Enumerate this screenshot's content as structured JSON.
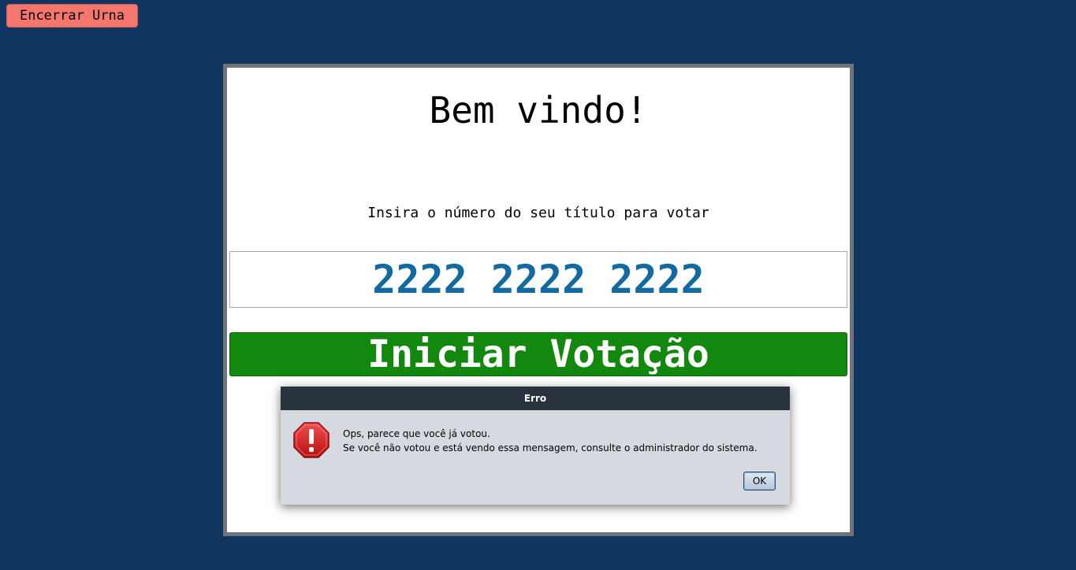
{
  "header": {
    "close_ballot_label": "Encerrar Urna"
  },
  "panel": {
    "welcome": "Bem vindo!",
    "instruction": "Insira o número do seu título para votar",
    "title_input_value": "2222 2222 2222",
    "start_button_label": "Iniciar Votação"
  },
  "dialog": {
    "title": "Erro",
    "icon": "error-warning-icon",
    "message_line1": "Ops, parece que você já votou.",
    "message_line2": "Se você não votou e está vendo essa mensagem, consulte o administrador do sistema.",
    "ok_label": "OK"
  },
  "colors": {
    "background": "#0f3660",
    "close_button": "#f6766e",
    "start_button": "#13880f",
    "input_text": "#136aa0",
    "dialog_titlebar": "#29333d",
    "dialog_body": "#d6d9df",
    "error_icon": "#d41f1f"
  }
}
